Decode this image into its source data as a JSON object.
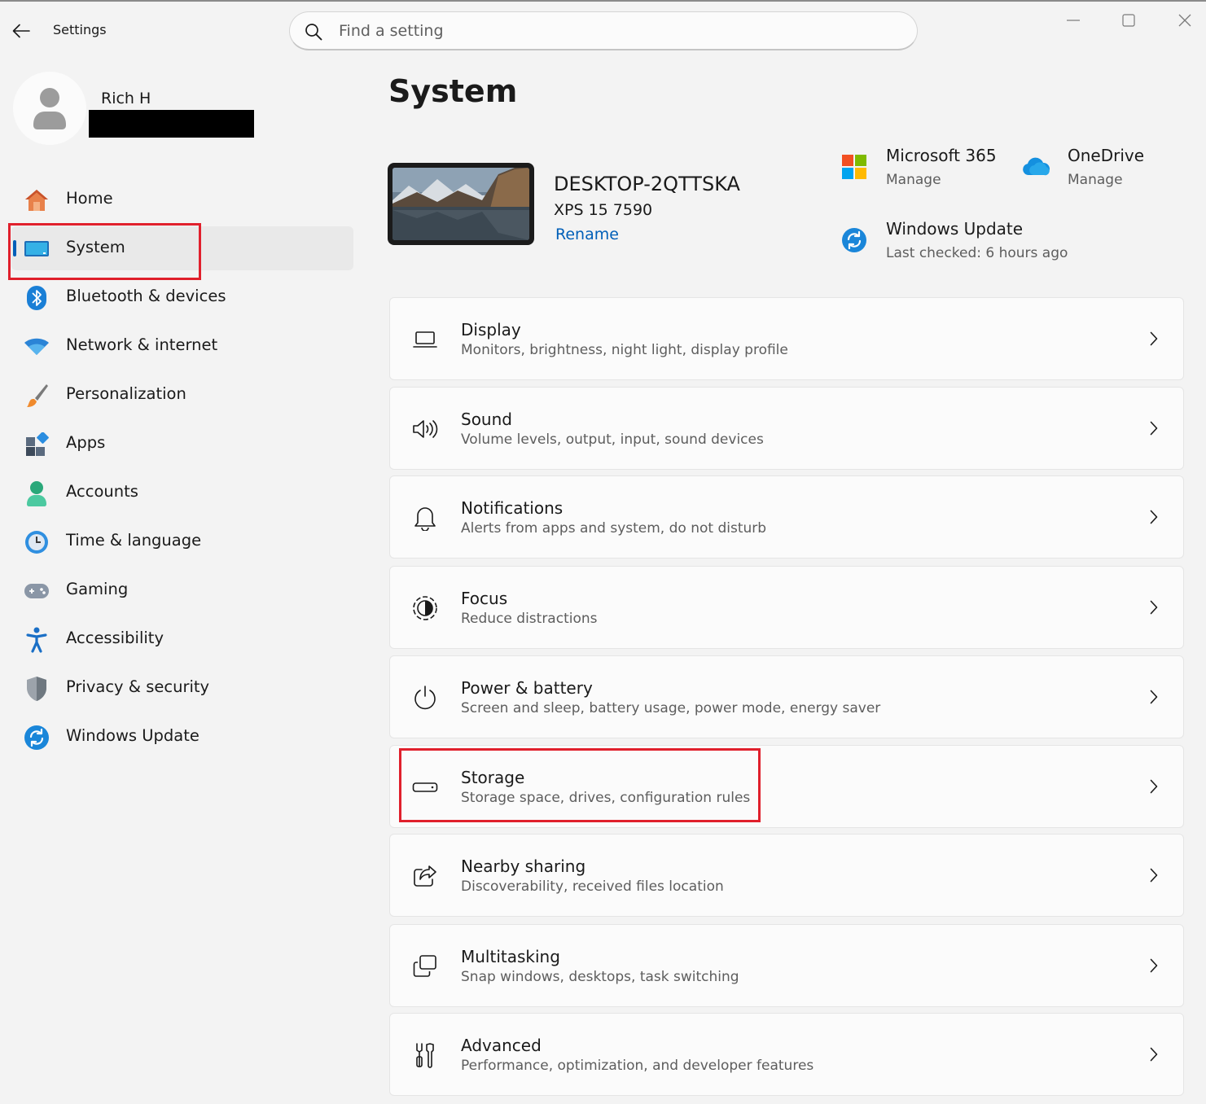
{
  "window": {
    "app_title": "Settings",
    "minimize_icon": "minimize-icon",
    "maximize_icon": "maximize-icon",
    "close_icon": "close-icon"
  },
  "search": {
    "placeholder": "Find a setting",
    "value": ""
  },
  "profile": {
    "name": "Rich H"
  },
  "sidebar": {
    "items": [
      {
        "label": "Home",
        "icon": "home-icon"
      },
      {
        "label": "System",
        "icon": "system-icon",
        "selected": true
      },
      {
        "label": "Bluetooth & devices",
        "icon": "bluetooth-icon"
      },
      {
        "label": "Network & internet",
        "icon": "wifi-icon"
      },
      {
        "label": "Personalization",
        "icon": "brush-icon"
      },
      {
        "label": "Apps",
        "icon": "apps-icon"
      },
      {
        "label": "Accounts",
        "icon": "accounts-icon"
      },
      {
        "label": "Time & language",
        "icon": "time-language-icon"
      },
      {
        "label": "Gaming",
        "icon": "gamepad-icon"
      },
      {
        "label": "Accessibility",
        "icon": "accessibility-icon"
      },
      {
        "label": "Privacy & security",
        "icon": "shield-icon"
      },
      {
        "label": "Windows Update",
        "icon": "windows-update-icon"
      }
    ]
  },
  "main": {
    "title": "System",
    "device": {
      "name": "DESKTOP-2QTTSKA",
      "model": "XPS 15 7590",
      "rename_label": "Rename"
    },
    "tiles": [
      {
        "title": "Microsoft 365",
        "subtitle": "Manage",
        "icon": "microsoft-365-icon"
      },
      {
        "title": "OneDrive",
        "subtitle": "Manage",
        "icon": "onedrive-icon"
      },
      {
        "title": "Windows Update",
        "subtitle": "Last checked: 6 hours ago",
        "icon": "windows-update-icon"
      }
    ],
    "cards": [
      {
        "title": "Display",
        "subtitle": "Monitors, brightness, night light, display profile",
        "icon": "display-icon"
      },
      {
        "title": "Sound",
        "subtitle": "Volume levels, output, input, sound devices",
        "icon": "speaker-icon"
      },
      {
        "title": "Notifications",
        "subtitle": "Alerts from apps and system, do not disturb",
        "icon": "bell-icon"
      },
      {
        "title": "Focus",
        "subtitle": "Reduce distractions",
        "icon": "focus-icon"
      },
      {
        "title": "Power & battery",
        "subtitle": "Screen and sleep, battery usage, power mode, energy saver",
        "icon": "power-icon"
      },
      {
        "title": "Storage",
        "subtitle": "Storage space, drives, configuration rules",
        "icon": "storage-icon"
      },
      {
        "title": "Nearby sharing",
        "subtitle": "Discoverability, received files location",
        "icon": "share-icon"
      },
      {
        "title": "Multitasking",
        "subtitle": "Snap windows, desktops, task switching",
        "icon": "multitasking-icon"
      },
      {
        "title": "Advanced",
        "subtitle": "Performance, optimization, and developer features",
        "icon": "tools-icon"
      }
    ]
  },
  "annotation_color": "#e0202c",
  "accent_color": "#005fb8"
}
